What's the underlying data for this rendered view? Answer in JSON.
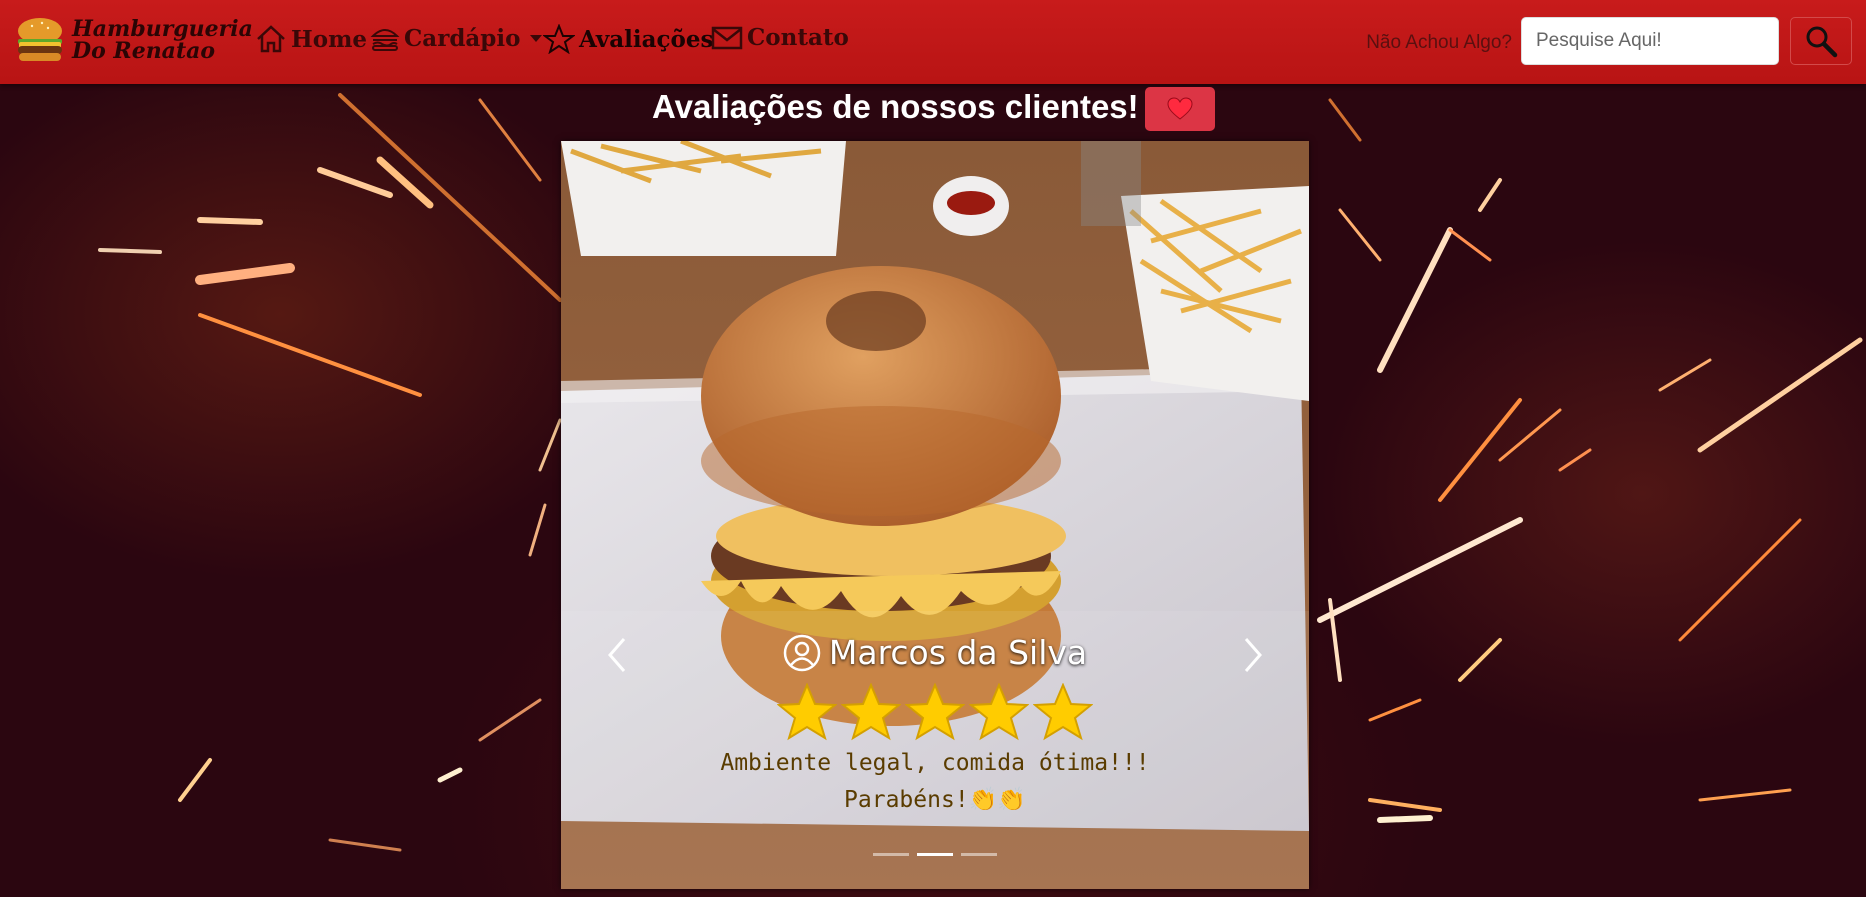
{
  "brand": {
    "line1": "Hamburgueria",
    "line2": "Do Renatao",
    "logo_icon": "burger-icon"
  },
  "nav": {
    "home": "Home",
    "cardapio": "Cardápio",
    "avaliacoes": "Avaliações",
    "contato": "Contato"
  },
  "search": {
    "label": "Não Achou Algo?",
    "placeholder": "Pesquise Aqui!",
    "button_icon": "magnifier-icon"
  },
  "page": {
    "heading": "Avaliações de nossos clientes!",
    "heart_button_icon": "heart-icon"
  },
  "carousel": {
    "reviewer": "Marcos da Silva",
    "rating": 5,
    "rating_max": 5,
    "review_line1": "Ambiente legal, comida ótima!!!",
    "review_line2": "Parabéns!👏👏",
    "slides": 3,
    "active_slide": 2
  },
  "colors": {
    "navbar": "#c81b1b",
    "heart_button": "#dc3545",
    "star": "#ffcc00"
  }
}
